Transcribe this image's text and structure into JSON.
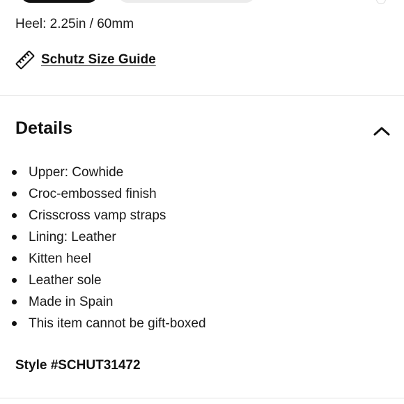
{
  "product": {
    "heel_text": "Heel: 2.25in / 60mm",
    "size_guide_label": "Schutz Size Guide",
    "size_guide_icon": "ruler-icon"
  },
  "details": {
    "title": "Details",
    "toggle_icon": "chevron-up-icon",
    "expanded": true,
    "items": [
      "Upper: Cowhide",
      "Croc-embossed finish",
      "Crisscross vamp straps",
      "Lining: Leather",
      "Kitten heel",
      "Leather sole",
      "Made in Spain",
      "This item cannot be gift-boxed"
    ],
    "style_number": "Style #SCHUT31472"
  },
  "colors": {
    "text": "#1a1a1a",
    "divider": "#e2e2e2",
    "selected_option": "#111111",
    "unselected_option": "#ececec"
  }
}
